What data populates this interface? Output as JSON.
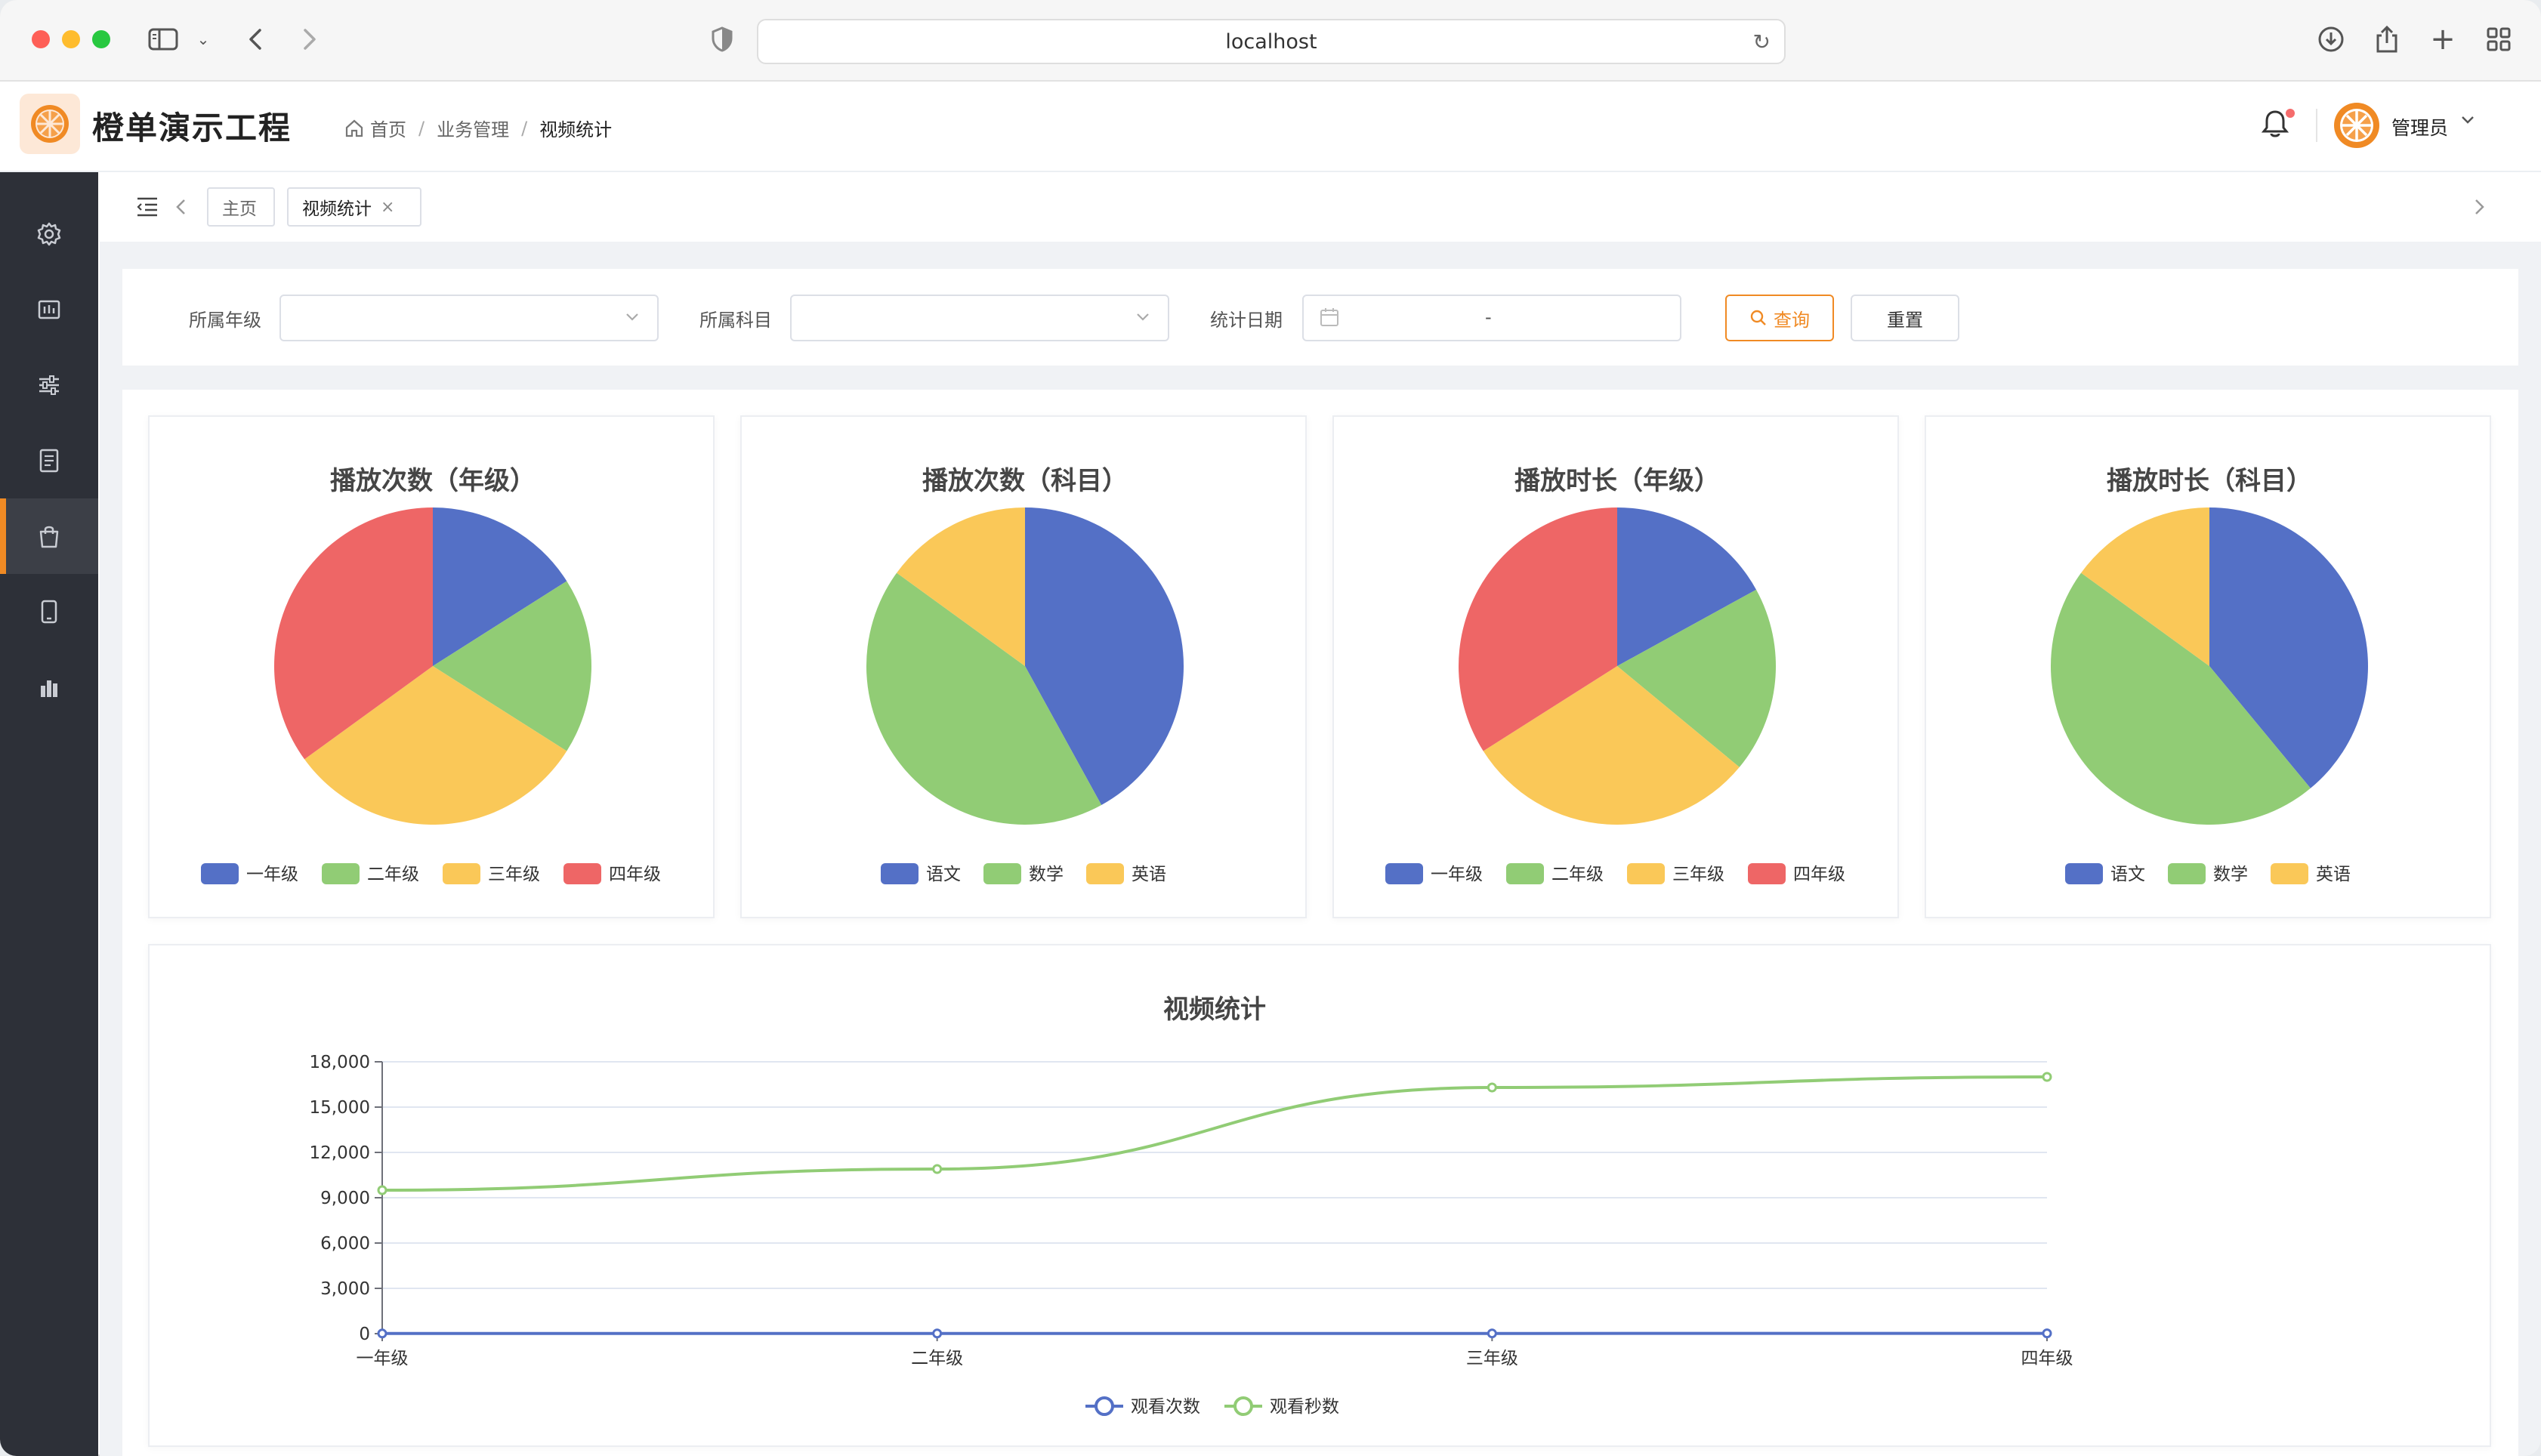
{
  "browser": {
    "url": "localhost"
  },
  "header": {
    "app_title": "橙单演示工程",
    "breadcrumb": [
      "首页",
      "业务管理",
      "视频统计"
    ],
    "user_name": "管理员"
  },
  "sidebar": {
    "items": [
      {
        "icon": "gear-icon"
      },
      {
        "icon": "dashboard-icon"
      },
      {
        "icon": "sliders-icon"
      },
      {
        "icon": "document-icon"
      },
      {
        "icon": "shopping-bag-icon",
        "active": true
      },
      {
        "icon": "tablet-icon"
      },
      {
        "icon": "bar-chart-icon"
      }
    ]
  },
  "tabs": {
    "items": [
      {
        "label": "主页"
      },
      {
        "label": "视频统计",
        "closable": true
      }
    ]
  },
  "filters": {
    "grade_label": "所属年级",
    "subject_label": "所属科目",
    "date_label": "统计日期",
    "date_separator": "-",
    "query_label": "查询",
    "reset_label": "重置"
  },
  "colors": {
    "accent": "#f08a24",
    "series": [
      "#5470c6",
      "#91cc75",
      "#fac858",
      "#ee6666"
    ]
  },
  "chart_data": [
    {
      "type": "pie",
      "title": "播放次数（年级）",
      "categories": [
        "一年级",
        "二年级",
        "三年级",
        "四年级"
      ],
      "values": [
        16,
        18,
        31,
        35
      ]
    },
    {
      "type": "pie",
      "title": "播放次数（科目）",
      "categories": [
        "语文",
        "数学",
        "英语"
      ],
      "values": [
        42,
        43,
        15
      ]
    },
    {
      "type": "pie",
      "title": "播放时长（年级）",
      "categories": [
        "一年级",
        "二年级",
        "三年级",
        "四年级"
      ],
      "values": [
        17,
        19,
        30,
        34
      ]
    },
    {
      "type": "pie",
      "title": "播放时长（科目）",
      "categories": [
        "语文",
        "数学",
        "英语"
      ],
      "values": [
        39,
        46,
        15
      ]
    },
    {
      "type": "line",
      "title": "视频统计",
      "categories": [
        "一年级",
        "二年级",
        "三年级",
        "四年级"
      ],
      "ylim": [
        0,
        18000
      ],
      "yticks": [
        "0",
        "3,000",
        "6,000",
        "9,000",
        "12,000",
        "15,000",
        "18,000"
      ],
      "series": [
        {
          "name": "观看次数",
          "values": [
            10,
            12,
            15,
            18
          ]
        },
        {
          "name": "观看秒数",
          "values": [
            9500,
            10900,
            16300,
            17000
          ]
        }
      ],
      "smooth": true,
      "grid": true,
      "legend": "bottom-center"
    }
  ]
}
